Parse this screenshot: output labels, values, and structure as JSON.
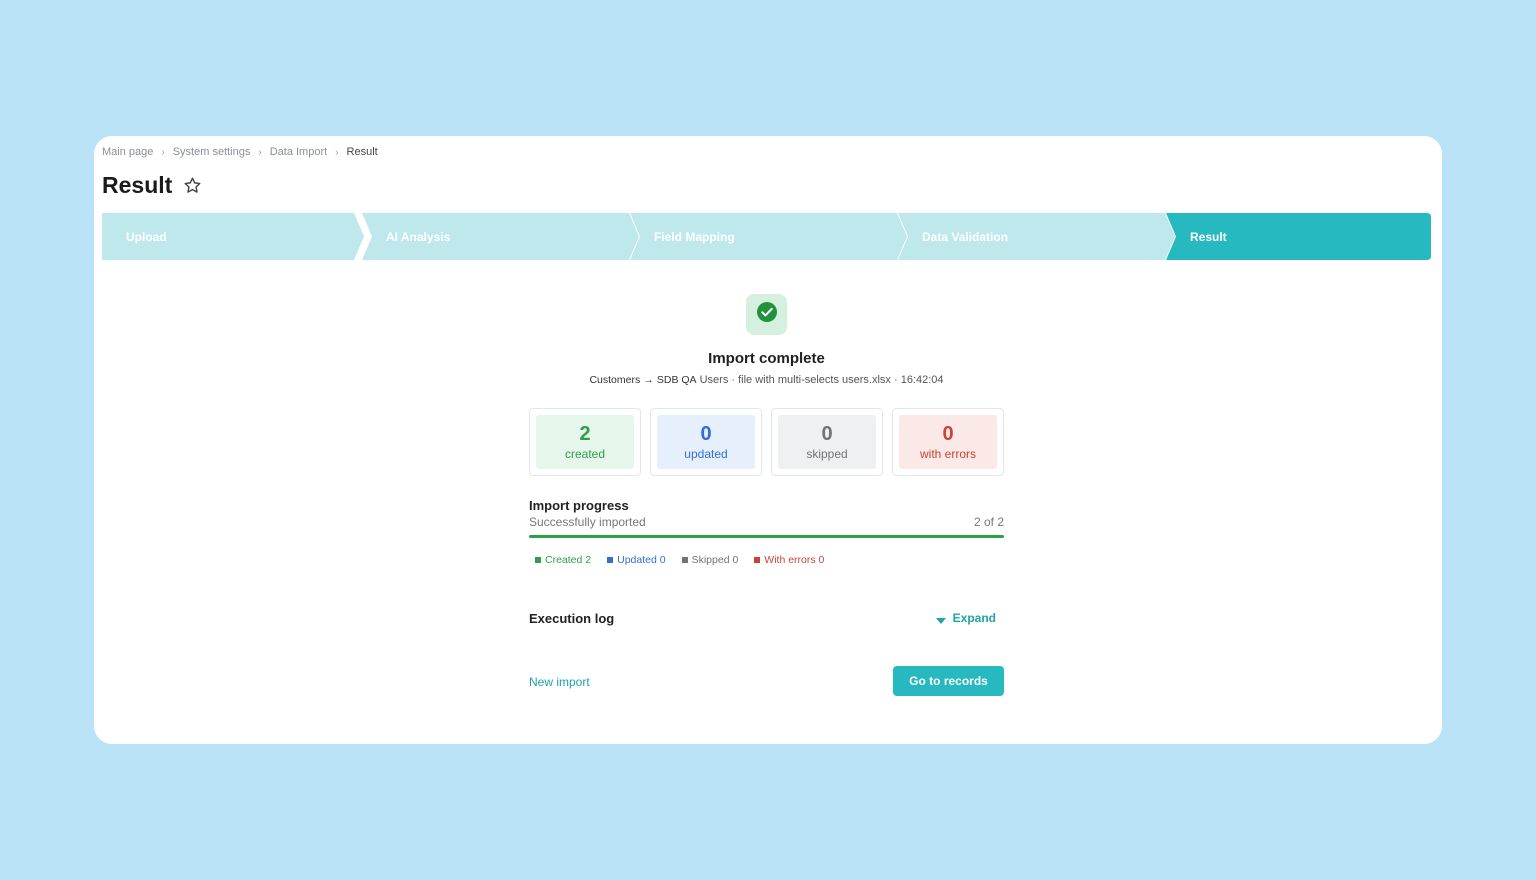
{
  "breadcrumb": {
    "items": [
      "Main page",
      "System settings",
      "Data Import"
    ],
    "current": "Result"
  },
  "header": {
    "title": "Result"
  },
  "stepper": {
    "steps": [
      {
        "label": "Upload",
        "active": false
      },
      {
        "label": "AI Analysis",
        "active": false
      },
      {
        "label": "Field Mapping",
        "active": false
      },
      {
        "label": "Data Validation",
        "active": false
      },
      {
        "label": "Result",
        "active": true
      }
    ],
    "active_color": "#27b9c0",
    "inactive_color": "#bee8ec"
  },
  "result": {
    "headline": "Import complete",
    "source": "Customers",
    "arrow": "→",
    "target": "SDB QA",
    "details": "Users · file with multi-selects users.xlsx · 16:42:04"
  },
  "stats": [
    {
      "value": "2",
      "label": "created",
      "color": "#2e9e49",
      "bg": "#e6f6eb"
    },
    {
      "value": "0",
      "label": "updated",
      "color": "#2f6fd6",
      "bg": "#e6effc"
    },
    {
      "value": "0",
      "label": "skipped",
      "color": "#6f747a",
      "bg": "#eef0f2"
    },
    {
      "value": "0",
      "label": "with errors",
      "color": "#c94434",
      "bg": "#fbe9e7"
    }
  ],
  "progress": {
    "title": "Import progress",
    "subtitle": "Successfully imported",
    "count": "2 of 2",
    "fraction": 1.0,
    "legend": [
      {
        "label": "Created 2",
        "color": "#2e9e49"
      },
      {
        "label": "Updated 0",
        "color": "#2f6fd6"
      },
      {
        "label": "Skipped 0",
        "color": "#6f747a"
      },
      {
        "label": "With errors 0",
        "color": "#c94434"
      }
    ]
  },
  "log": {
    "title": "Execution log",
    "expand_label": "Expand"
  },
  "actions": {
    "new_import": "New import",
    "go_to_records": "Go to records"
  }
}
